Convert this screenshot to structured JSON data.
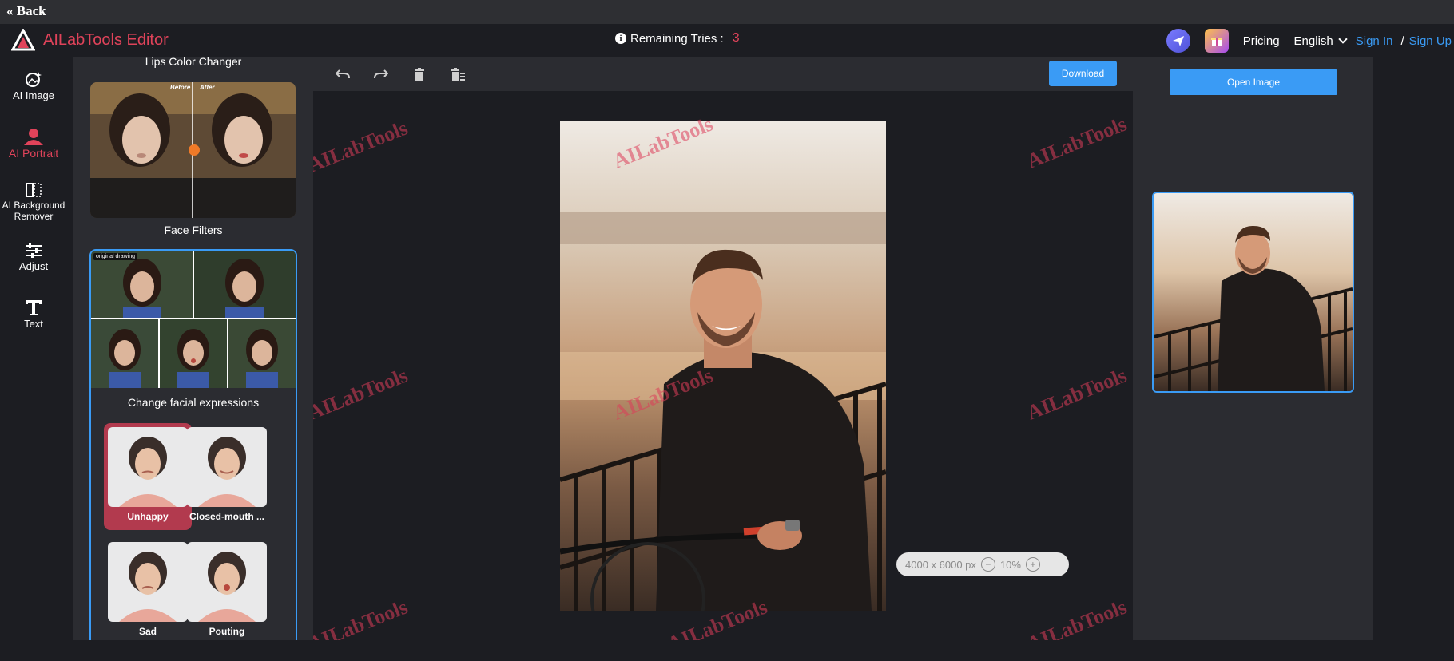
{
  "back": {
    "label": "« Back"
  },
  "app": {
    "title": "AILabTools Editor"
  },
  "tries": {
    "label": "Remaining Tries :",
    "count": "3"
  },
  "nav": {
    "pricing": "Pricing",
    "language": "English",
    "sign_in": "Sign In",
    "separator": "/",
    "sign_up": "Sign Up"
  },
  "rail": {
    "items": [
      {
        "label": "AI Image",
        "icon": "ai-image-icon"
      },
      {
        "label": "AI Portrait",
        "icon": "portrait-icon",
        "active": true
      },
      {
        "label": "AI Background Remover",
        "icon": "background-remover-icon"
      },
      {
        "label": "Adjust",
        "icon": "sliders-icon"
      },
      {
        "label": "Text",
        "icon": "text-icon"
      }
    ]
  },
  "tools": {
    "lips_title": "Lips Color Changer",
    "before": "Before",
    "after": "After",
    "face_filters_title": "Face Filters",
    "original_label": "original drawing",
    "expressions_title": "Change facial expressions",
    "expressions": [
      {
        "label": "Unhappy",
        "selected": true
      },
      {
        "label": "Closed-mouth ...",
        "selected": false
      },
      {
        "label": "Sad",
        "selected": false
      },
      {
        "label": "Pouting",
        "selected": false
      }
    ]
  },
  "toolbar": {
    "download": "Download",
    "icons": [
      "undo-icon",
      "redo-icon",
      "delete-icon",
      "delete-all-icon"
    ]
  },
  "canvas": {
    "watermark": "AILabTools",
    "dimensions": "4000 x 6000 px",
    "zoom": "10%"
  },
  "right": {
    "open_image": "Open Image"
  },
  "colors": {
    "accent_red": "#e0435a",
    "accent_blue": "#3a9bf5",
    "panel": "#2b2c31",
    "background": "#1c1d22"
  }
}
